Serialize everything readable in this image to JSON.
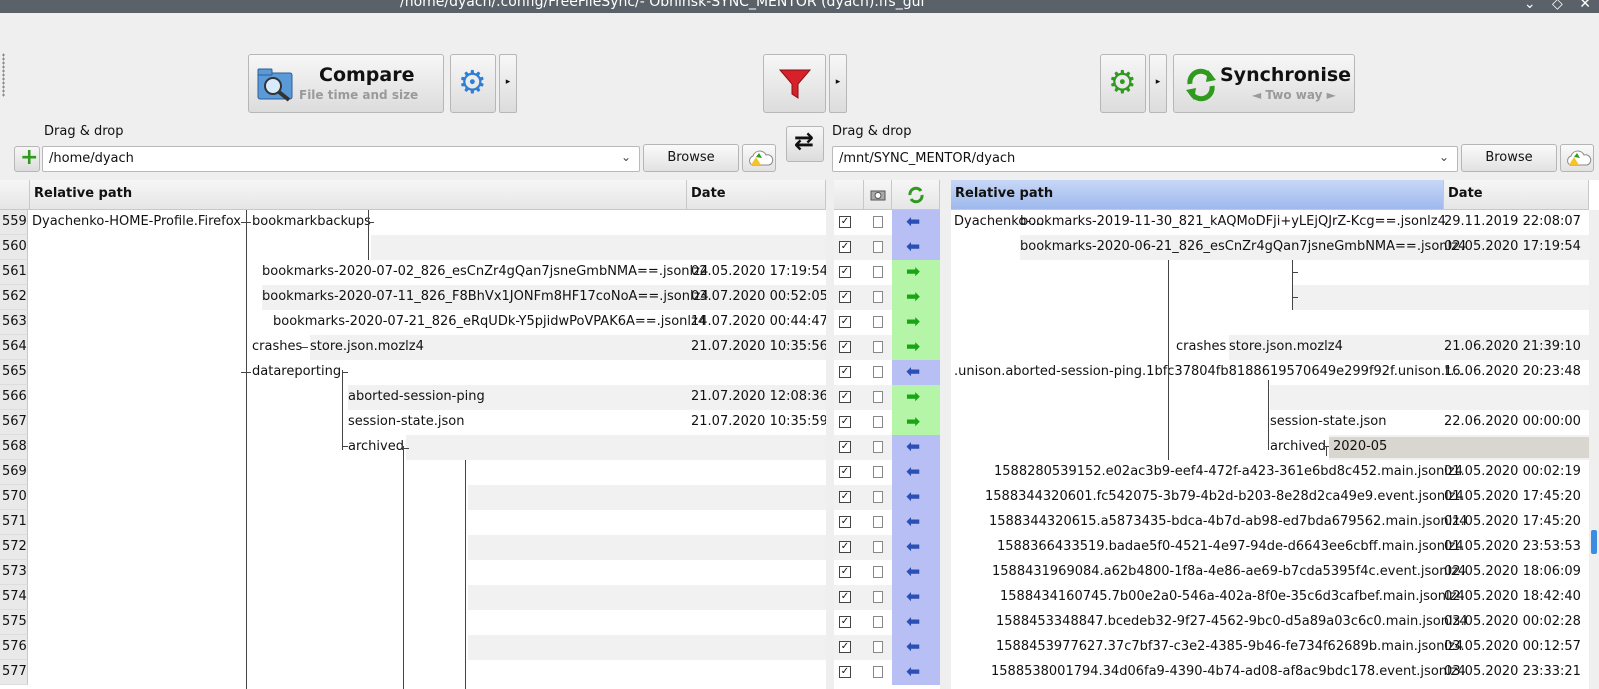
{
  "window": {
    "title": "/home/dyach/.config/FreeFileSync/- Obninsk-SYNC_MENTOR (dyach).ffs_gui",
    "controls": [
      "chevron-down-icon",
      "diamond-icon",
      "close-icon"
    ],
    "control_glyphs": [
      "⌄",
      "◇",
      "✕"
    ]
  },
  "toolbar": {
    "compare_label": "Compare",
    "compare_sub": "File time and size",
    "sync_label": "Synchronise",
    "sync_sub": "◄ Two way ►",
    "gear_glyph": "⚙",
    "filter_glyph": "▼",
    "arrow_glyph": "▸"
  },
  "left_folder": {
    "drag_label": "Drag & drop",
    "path": "/home/dyach",
    "browse_label": "Browse",
    "add_glyph": "+"
  },
  "right_folder": {
    "drag_label": "Drag & drop",
    "path": "/mnt/SYNC_MENTOR/dyach",
    "browse_label": "Browse"
  },
  "swap_glyph": "⇄",
  "columns": {
    "rel_path": "Relative path",
    "date": "Date"
  },
  "colors": {
    "blue_action": "#b8bff5",
    "green_action": "#b5f5a8",
    "header_selected": "#9fb9ee"
  },
  "rows": [
    {
      "n": "559",
      "l_a": "Dyachenko-HOME-Profile.Firefox",
      "l_b": "bookmarkbackups",
      "l_date": "",
      "r_a": "Dyachenko-…",
      "r_b": "bookmarks-2019-11-30_821_kAQMoDFji+yLEjQJrZ-Kcg==.jsonlz4",
      "r_date": "29.11.2019  22:08:07",
      "action": "blue",
      "glyph": "⬅"
    },
    {
      "n": "560",
      "l_a": "",
      "l_b": "",
      "l_date": "",
      "r_a": "",
      "r_b": "bookmarks-2020-06-21_826_esCnZr4gQan7jsneGmbNMA==.jsonlz4",
      "r_date": "02.05.2020  17:19:54",
      "action": "blue",
      "glyph": "⬅"
    },
    {
      "n": "561",
      "l_a": "",
      "l_b": "bookmarks-2020-07-02_826_esCnZr4gQan7jsneGmbNMA==.jsonlz4",
      "l_date": "02.05.2020  17:19:54",
      "r_a": "",
      "r_b": "",
      "r_date": "",
      "action": "green",
      "glyph": "➡"
    },
    {
      "n": "562",
      "l_a": "",
      "l_b": "bookmarks-2020-07-11_826_F8BhVx1JONFm8HF17coNoA==.jsonlz4",
      "l_date": "03.07.2020  00:52:05",
      "r_a": "",
      "r_b": "",
      "r_date": "",
      "action": "green",
      "glyph": "➡"
    },
    {
      "n": "563",
      "l_a": "",
      "l_b": "bookmarks-2020-07-21_826_eRqUDk-Y5pjidwPoVPAK6A==.jsonlz4",
      "l_date": "14.07.2020  00:44:47",
      "r_a": "",
      "r_b": "",
      "r_date": "",
      "action": "green",
      "glyph": "➡"
    },
    {
      "n": "564",
      "l_a": "crashes",
      "l_b": "store.json.mozlz4",
      "l_date": "21.07.2020  10:35:56",
      "r_a": "crashes",
      "r_b": "store.json.mozlz4",
      "r_date": "21.06.2020  21:39:10",
      "action": "green",
      "glyph": "➡"
    },
    {
      "n": "565",
      "l_a": "datareporting",
      "l_b": "",
      "l_date": "",
      "r_a": "",
      "r_b": ".unison.aborted-session-ping.1bfc37804fb8188619570649e299f92f.unison.t…",
      "r_date": "16.06.2020  20:23:48",
      "action": "blue",
      "glyph": "⬅"
    },
    {
      "n": "566",
      "l_a": "",
      "l_b": "aborted-session-ping",
      "l_date": "21.07.2020  12:08:36",
      "r_a": "",
      "r_b": "",
      "r_date": "",
      "action": "green",
      "glyph": "➡"
    },
    {
      "n": "567",
      "l_a": "",
      "l_b": "session-state.json",
      "l_date": "21.07.2020  10:35:59",
      "r_a": "",
      "r_b": "session-state.json",
      "r_date": "22.06.2020  00:00:00",
      "action": "green",
      "glyph": "➡"
    },
    {
      "n": "568",
      "l_a": "",
      "l_b": "archived",
      "l_date": "",
      "r_a": "archived",
      "r_b": "2020-05",
      "r_date": "",
      "action": "blue",
      "glyph": "⬅"
    },
    {
      "n": "569",
      "l_a": "",
      "l_b": "",
      "l_date": "",
      "r_a": "",
      "r_b": "1588280539152.e02ac3b9-eef4-472f-a423-361e6bd8c452.main.jsonlz4",
      "r_date": "01.05.2020  00:02:19",
      "action": "blue",
      "glyph": "⬅"
    },
    {
      "n": "570",
      "l_a": "",
      "l_b": "",
      "l_date": "",
      "r_a": "",
      "r_b": "1588344320601.fc542075-3b79-4b2d-b203-8e28d2ca49e9.event.jsonlz4",
      "r_date": "01.05.2020  17:45:20",
      "action": "blue",
      "glyph": "⬅"
    },
    {
      "n": "571",
      "l_a": "",
      "l_b": "",
      "l_date": "",
      "r_a": "",
      "r_b": "1588344320615.a5873435-bdca-4b7d-ab98-ed7bda679562.main.jsonlz4",
      "r_date": "01.05.2020  17:45:20",
      "action": "blue",
      "glyph": "⬅"
    },
    {
      "n": "572",
      "l_a": "",
      "l_b": "",
      "l_date": "",
      "r_a": "",
      "r_b": "1588366433519.badae5f0-4521-4e97-94de-d6643ee6cbff.main.jsonlz4",
      "r_date": "01.05.2020  23:53:53",
      "action": "blue",
      "glyph": "⬅"
    },
    {
      "n": "573",
      "l_a": "",
      "l_b": "",
      "l_date": "",
      "r_a": "",
      "r_b": "1588431969084.a62b4800-1f8a-4e86-ae69-b7cda5395f4c.event.jsonlz4",
      "r_date": "02.05.2020  18:06:09",
      "action": "blue",
      "glyph": "⬅"
    },
    {
      "n": "574",
      "l_a": "",
      "l_b": "",
      "l_date": "",
      "r_a": "",
      "r_b": "1588434160745.7b00e2a0-546a-402a-8f0e-35c6d3cafbef.main.jsonlz4",
      "r_date": "02.05.2020  18:42:40",
      "action": "blue",
      "glyph": "⬅"
    },
    {
      "n": "575",
      "l_a": "",
      "l_b": "",
      "l_date": "",
      "r_a": "",
      "r_b": "1588453348847.bcedeb32-9f27-4562-9bc0-d5a89a03c6c0.main.jsonlz4",
      "r_date": "03.05.2020  00:02:28",
      "action": "blue",
      "glyph": "⬅"
    },
    {
      "n": "576",
      "l_a": "",
      "l_b": "",
      "l_date": "",
      "r_a": "",
      "r_b": "1588453977627.37c7bf37-c3e2-4385-9b46-fe734f62689b.main.jsonlz4",
      "r_date": "03.05.2020  00:12:57",
      "action": "blue",
      "glyph": "⬅"
    },
    {
      "n": "577",
      "l_a": "",
      "l_b": "",
      "l_date": "",
      "r_a": "",
      "r_b": "1588538001794.34d06fa9-4390-4b74-ad08-af8ac9bdc178.event.jsonlz4",
      "r_date": "03.05.2020  23:33:21",
      "action": "blue",
      "glyph": "⬅"
    }
  ]
}
